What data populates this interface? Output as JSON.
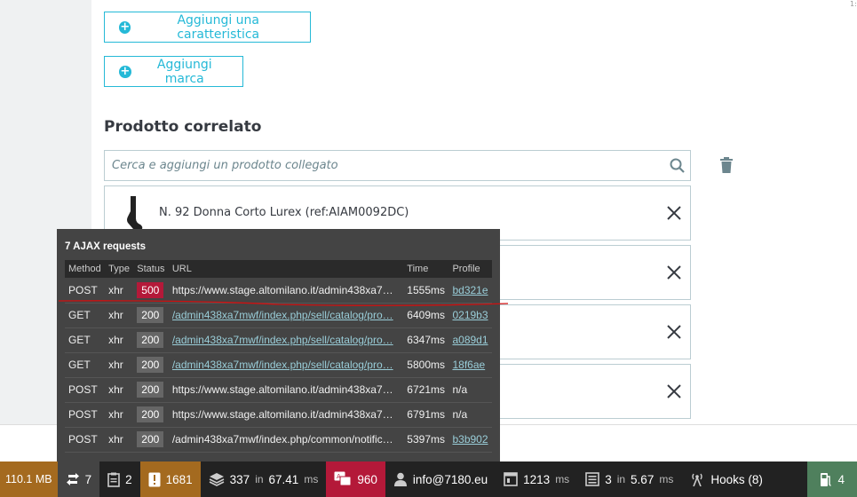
{
  "top_right_fragment": "1:",
  "buttons": {
    "add_feature": "Aggiungi una caratteristica",
    "add_brand": "Aggiungi marca"
  },
  "related": {
    "title": "Prodotto correlato",
    "search_placeholder": "Cerca e aggiungi un prodotto collegato",
    "products": [
      {
        "name": "N. 92 Donna Corto Lurex (ref:AIAM0092DC)"
      },
      {
        "name": ""
      },
      {
        "name": ""
      },
      {
        "name": ""
      }
    ]
  },
  "ajax": {
    "title": "7 AJAX requests",
    "headers": {
      "method": "Method",
      "type": "Type",
      "status": "Status",
      "url": "URL",
      "time": "Time",
      "profile": "Profile"
    },
    "rows": [
      {
        "method": "POST",
        "type": "xhr",
        "status": "500",
        "url": "https://www.stage.altomilano.it/admin438xa7…",
        "time": "1555ms",
        "profile": "bd321e"
      },
      {
        "method": "GET",
        "type": "xhr",
        "status": "200",
        "url": "/admin438xa7mwf/index.php/sell/catalog/pro…",
        "time": "6409ms",
        "profile": "0219b3"
      },
      {
        "method": "GET",
        "type": "xhr",
        "status": "200",
        "url": "/admin438xa7mwf/index.php/sell/catalog/pro…",
        "time": "6347ms",
        "profile": "a089d1"
      },
      {
        "method": "GET",
        "type": "xhr",
        "status": "200",
        "url": "/admin438xa7mwf/index.php/sell/catalog/pro…",
        "time": "5800ms",
        "profile": "18f6ae"
      },
      {
        "method": "POST",
        "type": "xhr",
        "status": "200",
        "url": "https://www.stage.altomilano.it/admin438xa7…",
        "time": "6721ms",
        "profile": "n/a"
      },
      {
        "method": "POST",
        "type": "xhr",
        "status": "200",
        "url": "https://www.stage.altomilano.it/admin438xa7…",
        "time": "6791ms",
        "profile": "n/a"
      },
      {
        "method": "POST",
        "type": "xhr",
        "status": "200",
        "url": "/admin438xa7mwf/index.php/common/notific…",
        "time": "5397ms",
        "profile": "b3b902"
      }
    ]
  },
  "toolbar": {
    "memory": "110.1 MB",
    "ajax_count": "7",
    "logs": "2",
    "deprecations": "1681",
    "db_queries": "337",
    "db_in": "in",
    "db_time": "67.41",
    "db_unit": "ms",
    "errors": "960",
    "user": "info@7180.eu",
    "time": "1213",
    "time_unit": "ms",
    "cache": "3",
    "cache_in": "in",
    "cache_time": "5.67",
    "cache_unit": "ms",
    "hooks": "Hooks (8)",
    "status": "4"
  },
  "colors": {
    "accent": "#25b9d7",
    "error": "#b41939",
    "warning": "#a46a1f",
    "success": "#4f805d"
  }
}
